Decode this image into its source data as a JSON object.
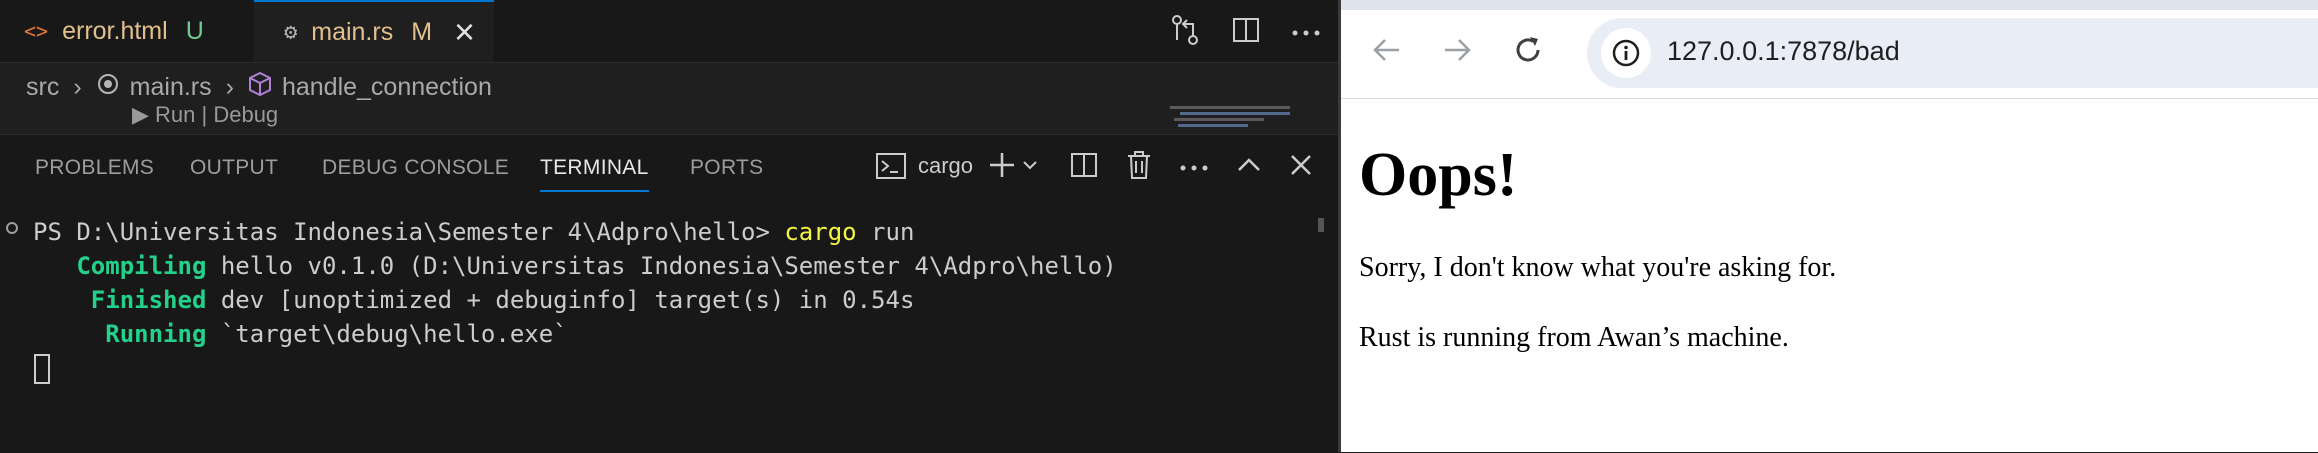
{
  "vscode": {
    "tabs": [
      {
        "icon": "<>",
        "label": "error.html",
        "status": "U",
        "label_color": "#e2c08d",
        "status_color": "#73c991"
      },
      {
        "icon": "⚙",
        "label": "main.rs",
        "status": "M",
        "label_color": "#e2c08d",
        "status_color": "#e2c08d"
      }
    ],
    "close_glyph": "×",
    "breadcrumb": {
      "parts": [
        "src",
        "main.rs",
        "handle_connection"
      ],
      "separator": "›"
    },
    "codelens": "▶ Run | Debug",
    "panel": {
      "tabs": [
        "PROBLEMS",
        "OUTPUT",
        "DEBUG CONSOLE",
        "TERMINAL",
        "PORTS"
      ],
      "active_tab": "TERMINAL",
      "terminal_name": "cargo"
    },
    "terminal": {
      "prompt": "PS D:\\Universitas Indonesia\\Semester 4\\Adpro\\hello> ",
      "command": "cargo",
      "command_args": " run",
      "lines": [
        {
          "keyword": "   Compiling",
          "text": " hello v0.1.0 (D:\\Universitas Indonesia\\Semester 4\\Adpro\\hello)"
        },
        {
          "keyword": "    Finished",
          "text": " dev [unoptimized + debuginfo] target(s) in 0.54s"
        },
        {
          "keyword": "     Running",
          "text": " `target\\debug\\hello.exe`"
        }
      ]
    }
  },
  "browser": {
    "url": "127.0.0.1:7878/bad",
    "page": {
      "heading": "Oops!",
      "paragraphs": [
        "Sorry, I don't know what you're asking for.",
        "Rust is running from Awan’s machine."
      ]
    }
  },
  "colors": {
    "accent": "#0078d4",
    "terminal_green": "#23d18b",
    "terminal_yellow": "#f5f543"
  }
}
